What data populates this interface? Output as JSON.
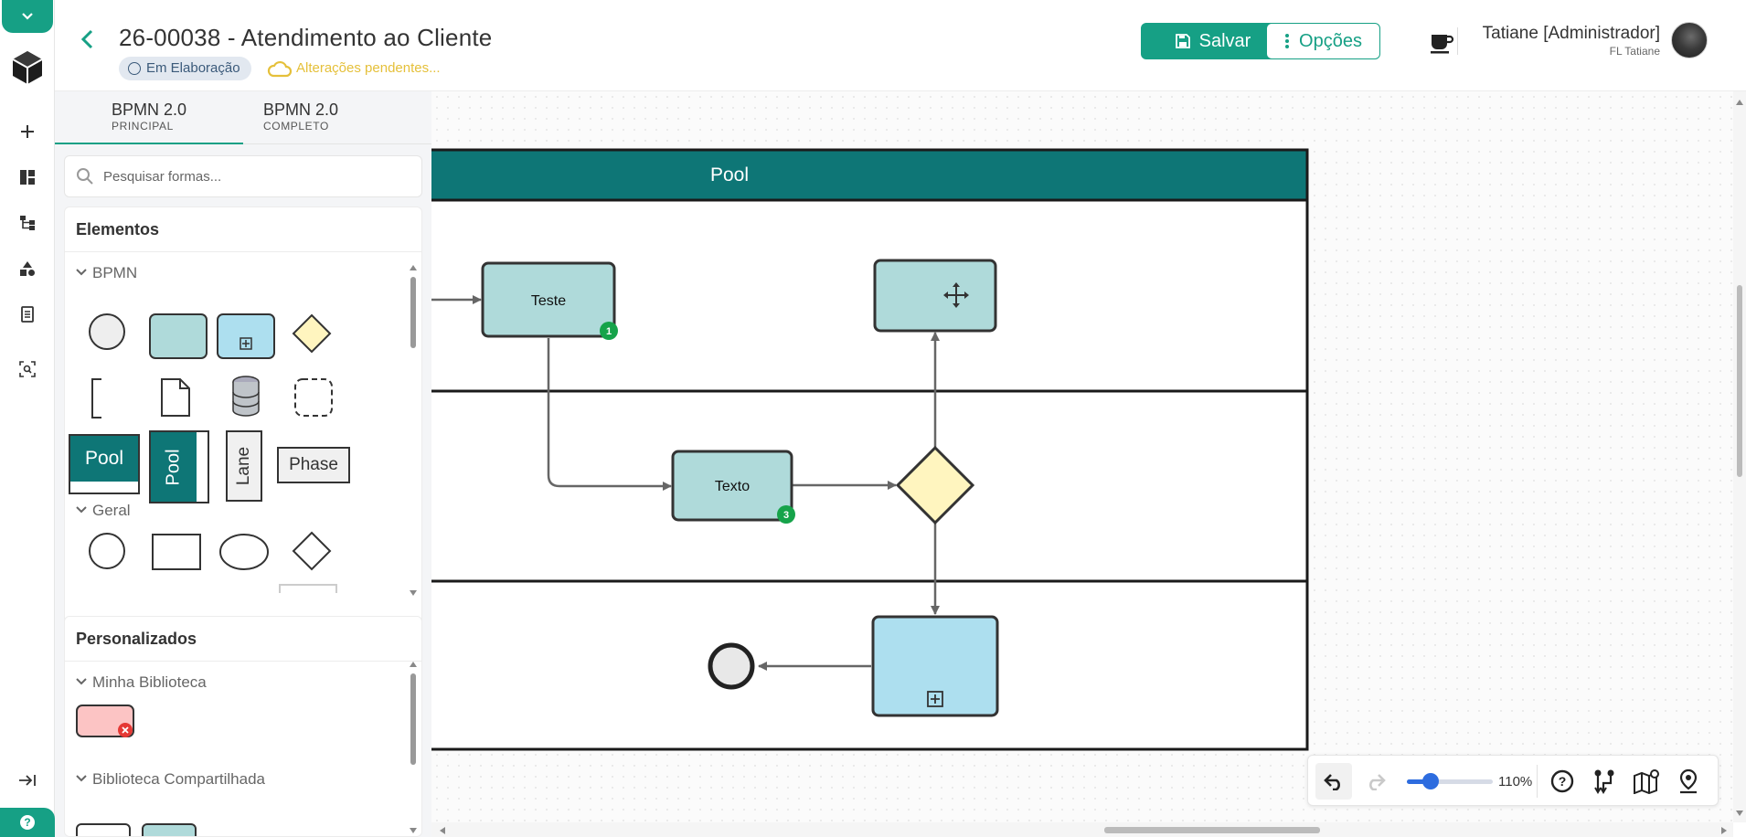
{
  "header": {
    "title": "26-00038 - Atendimento ao Cliente",
    "status": "Em Elaboração",
    "pending": "Alterações pendentes...",
    "save_label": "Salvar",
    "options_label": "Opções",
    "user_name": "Tatiane [Administrador]",
    "user_sub": "FL Tatiane"
  },
  "tabs": [
    {
      "label": "BPMN 2.0",
      "sub": "PRINCIPAL"
    },
    {
      "label": "BPMN 2.0",
      "sub": "COMPLETO"
    }
  ],
  "search": {
    "placeholder": "Pesquisar formas..."
  },
  "elements": {
    "title": "Elementos",
    "section_bpmn": "BPMN",
    "section_geral": "Geral",
    "pool_label": "Pool",
    "lane_label": "Lane",
    "phase_label": "Phase"
  },
  "custom": {
    "title": "Personalizados",
    "section_mine": "Minha Biblioteca",
    "section_shared": "Biblioteca Compartilhada"
  },
  "diagram": {
    "pool_title": "Pool",
    "task1_label": "Teste",
    "task1_badge": "1",
    "task2_label": "Texto",
    "task2_badge": "3"
  },
  "toolbar": {
    "zoom_label": "110%",
    "zoom_level": 0.28
  },
  "colors": {
    "accent": "#16a085",
    "pool_header": "#0e7676",
    "task_fill": "#afdada",
    "subprocess_fill": "#addfef",
    "gateway_fill": "#fff5bf",
    "badge": "#16a34a"
  }
}
